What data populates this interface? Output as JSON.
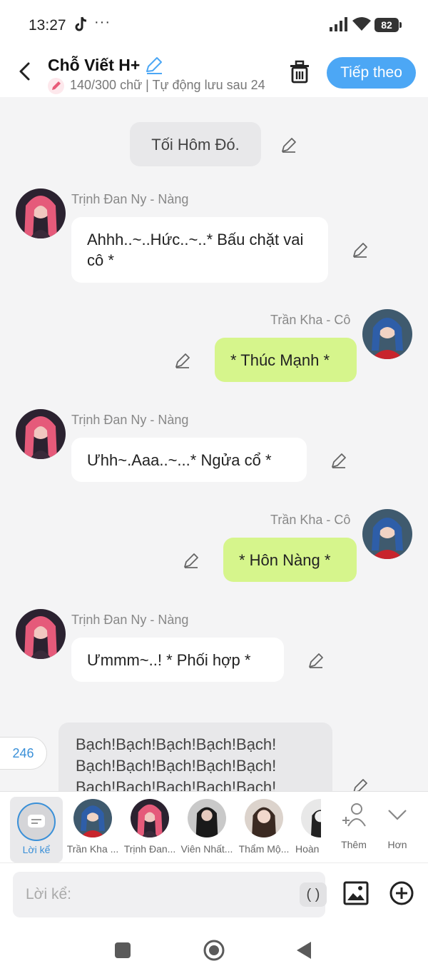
{
  "status_bar": {
    "time": "13:27",
    "dots": "···",
    "battery": "82"
  },
  "header": {
    "title": "Chỗ Viết H+",
    "subtitle": "140/300 chữ | Tự động lưu sau 24",
    "next_label": "Tiếp theo"
  },
  "messages": {
    "narr1": "Tối Hôm Đó.",
    "m1": {
      "name": "Trịnh Đan Ny - Nàng",
      "text": "Ahhh..~..Hức..~..* Bấu chặt vai cô *"
    },
    "m2": {
      "name": "Trần Kha - Cô",
      "text": "* Thúc Mạnh *"
    },
    "m3": {
      "name": "Trịnh Đan Ny - Nàng",
      "text": "Ưhh~.Aaa..~...* Ngửa cổ *"
    },
    "m4": {
      "name": "Trần Kha - Cô",
      "text": "* Hôn Nàng *"
    },
    "m5": {
      "name": "Trịnh Đan Ny - Nàng",
      "text": "Ưmmm~..! * Phối hợp *"
    },
    "narr2": "Bạch!Bạch!Bạch!Bạch!Bạch! Bạch!Bạch!Bạch!Bạch!Bạch! Bạch!Bạch!Bạch!Bạch!Bạch!"
  },
  "counter": "246",
  "characters": {
    "narrator": "Lời kể",
    "c1": "Trần Kha ...",
    "c2": "Trịnh Đan...",
    "c3": "Viên Nhất...",
    "c4": "Thẩm Mộ...",
    "c5": "Hoàn",
    "add": "Thêm",
    "more": "Hơn"
  },
  "input": {
    "placeholder": "Lời kể:",
    "paren": "( )"
  },
  "colors": {
    "accent": "#4ca7f5",
    "right_bubble": "#d6f58c",
    "left_bubble": "#ffffff",
    "narr_bubble": "#e8e8ea"
  },
  "icons": [
    "back-icon",
    "edit-pencil-icon",
    "trash-icon",
    "image-icon",
    "plus-circle-icon",
    "add-person-icon",
    "chevron-down-icon"
  ]
}
